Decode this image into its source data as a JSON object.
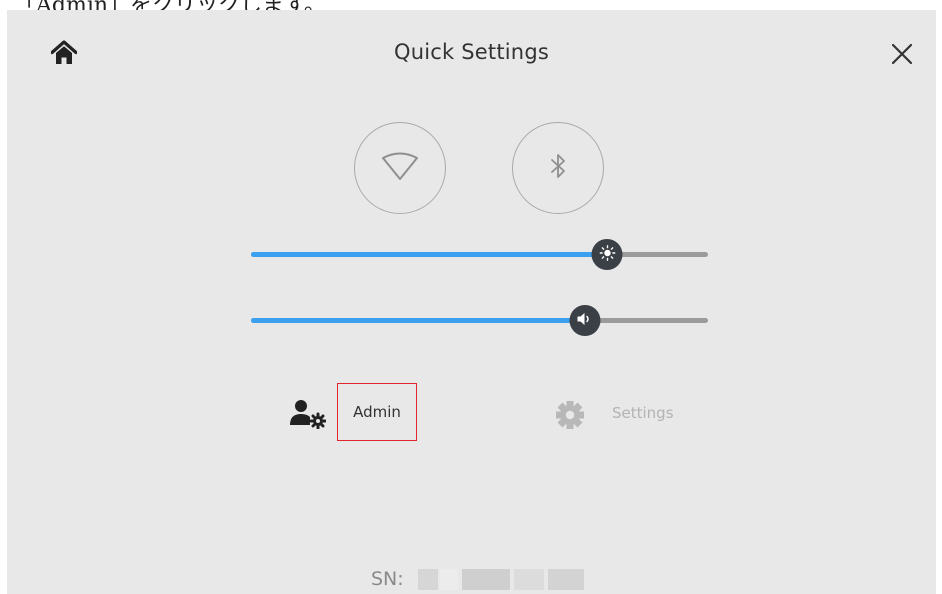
{
  "document": {
    "caption": "「Admin」をクリックします。"
  },
  "header": {
    "title": "Quick Settings",
    "home_icon": "home-icon",
    "close_icon": "close-icon"
  },
  "connectivity": {
    "wifi_icon": "wifi-icon",
    "bluetooth_icon": "bluetooth-icon"
  },
  "sliders": {
    "brightness": {
      "icon": "sun-icon",
      "level": 0.78
    },
    "volume": {
      "icon": "speaker-icon",
      "level": 0.73
    }
  },
  "actions": {
    "admin_label": "Admin",
    "admin_icon": "user-gear-icon",
    "settings_label": "Settings",
    "settings_icon": "gear-icon",
    "highlight_color": "#e0262c"
  },
  "footer": {
    "sn_label": "SN:"
  },
  "colors": {
    "accent": "#3aa0ef",
    "panel_background": "#e8e8e8",
    "thumb": "#3b3f46"
  }
}
